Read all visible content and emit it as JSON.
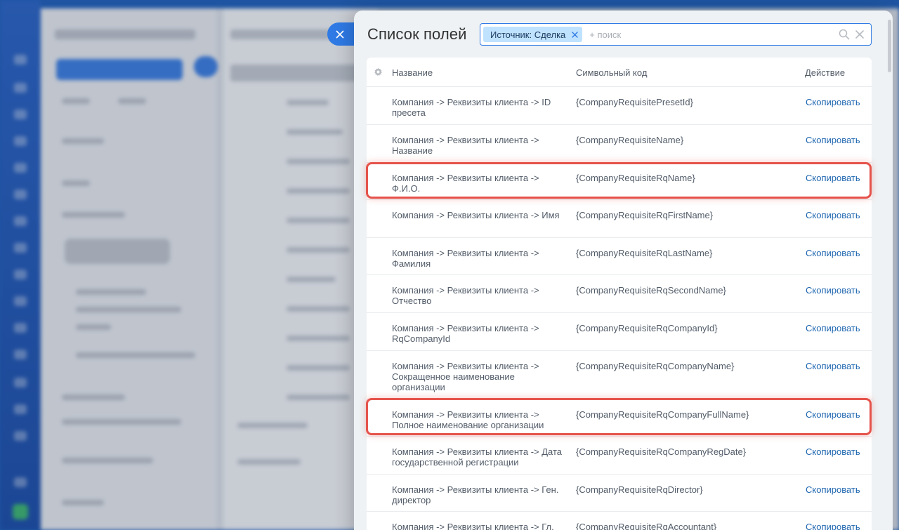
{
  "panel": {
    "title": "Список полей",
    "close_label": "Закрыть"
  },
  "search": {
    "chip_label": "Источник: Сделка",
    "placeholder": "+ поиск"
  },
  "table": {
    "columns": {
      "name": "Название",
      "code": "Символьный код",
      "action": "Действие"
    },
    "rows": [
      {
        "name": "Компания -> Реквизиты клиента -> ID пресета",
        "code": "{CompanyRequisitePresetId}",
        "action": "Скопировать"
      },
      {
        "name": "Компания -> Реквизиты клиента -> Название",
        "code": "{CompanyRequisiteName}",
        "action": "Скопировать"
      },
      {
        "name": "Компания -> Реквизиты клиента -> Ф.И.О.",
        "code": "{CompanyRequisiteRqName}",
        "action": "Скопировать"
      },
      {
        "name": "Компания -> Реквизиты клиента -> Имя",
        "code": "{CompanyRequisiteRqFirstName}",
        "action": "Скопировать"
      },
      {
        "name": "Компания -> Реквизиты клиента -> Фамилия",
        "code": "{CompanyRequisiteRqLastName}",
        "action": "Скопировать"
      },
      {
        "name": "Компания -> Реквизиты клиента -> Отчество",
        "code": "{CompanyRequisiteRqSecondName}",
        "action": "Скопировать"
      },
      {
        "name": "Компания -> Реквизиты клиента -> RqCompanyId",
        "code": "{CompanyRequisiteRqCompanyId}",
        "action": "Скопировать"
      },
      {
        "name": "Компания -> Реквизиты клиента -> Сокращенное наименование организации",
        "code": "{CompanyRequisiteRqCompanyName}",
        "action": "Скопировать"
      },
      {
        "name": "Компания -> Реквизиты клиента -> Полное наименование организации",
        "code": "{CompanyRequisiteRqCompanyFullName}",
        "action": "Скопировать"
      },
      {
        "name": "Компания -> Реквизиты клиента -> Дата государственной регистрации",
        "code": "{CompanyRequisiteRqCompanyRegDate}",
        "action": "Скопировать"
      },
      {
        "name": "Компания -> Реквизиты клиента -> Ген. директор",
        "code": "{CompanyRequisiteRqDirector}",
        "action": "Скопировать"
      },
      {
        "name": "Компания -> Реквизиты клиента -> Гл. бухгалтер",
        "code": "{CompanyRequisiteRqAccountant}",
        "action": "Скопировать"
      }
    ]
  },
  "colors": {
    "accent": "#2f7ae5",
    "link": "#2067b0",
    "highlight": "#e5534b"
  }
}
